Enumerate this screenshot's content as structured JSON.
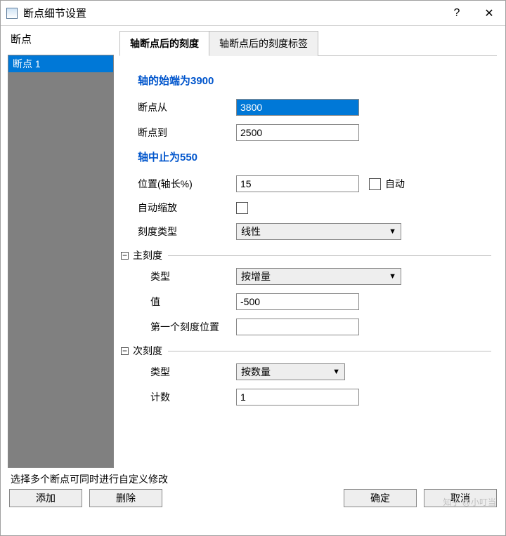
{
  "title": "断点细节设置",
  "help": "?",
  "close": "✕",
  "sidebar": {
    "header": "断点",
    "items": [
      "断点 1"
    ]
  },
  "tabs": [
    "轴断点后的刻度",
    "轴断点后的刻度标签"
  ],
  "form": {
    "start_hdr": "轴的始端为3900",
    "from_lbl": "断点从",
    "from_val": "3800",
    "to_lbl": "断点到",
    "to_val": "2500",
    "mid_hdr": "轴中止为550",
    "pos_lbl": "位置(轴长%)",
    "pos_val": "15",
    "auto_lbl": "自动",
    "scale_lbl": "自动缩放",
    "ticktype_lbl": "刻度类型",
    "ticktype_val": "线性",
    "major_hdr": "主刻度",
    "major_type_lbl": "类型",
    "major_type_val": "按增量",
    "major_val_lbl": "值",
    "major_val": "-500",
    "first_lbl": "第一个刻度位置",
    "first_val": "",
    "minor_hdr": "次刻度",
    "minor_type_lbl": "类型",
    "minor_type_val": "按数量",
    "minor_count_lbl": "计数",
    "minor_count_val": "1"
  },
  "hint": "选择多个断点可同时进行自定义修改",
  "buttons": {
    "add": "添加",
    "delete": "删除",
    "ok": "确定",
    "cancel": "取消"
  },
  "watermark": "知乎 @小叮当"
}
